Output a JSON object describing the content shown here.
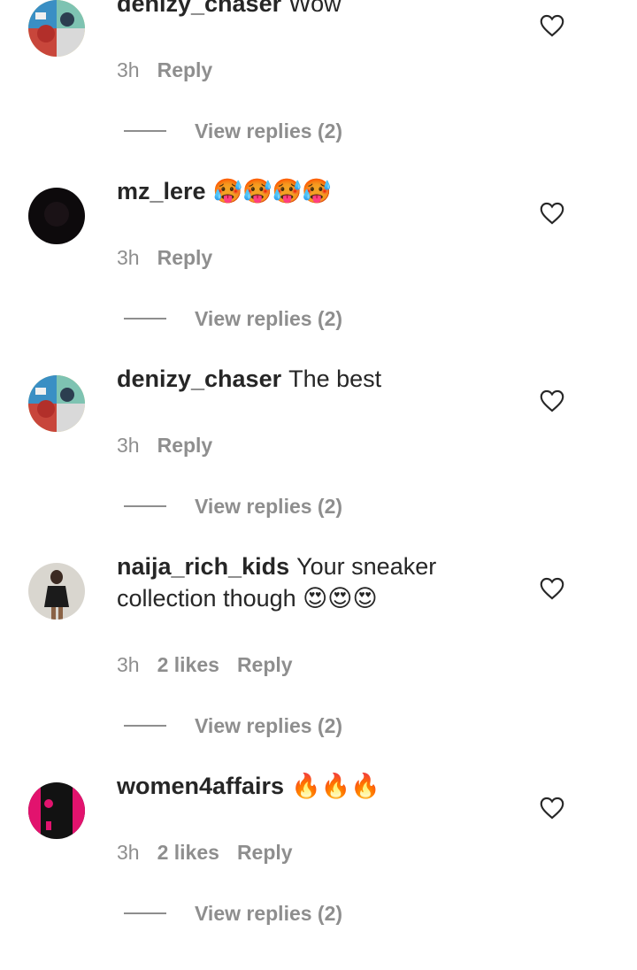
{
  "comments": [
    {
      "username": "denizy_chaser",
      "text": "Wow",
      "time": "3h",
      "likes": "",
      "reply_label": "Reply",
      "view_replies": "View replies (2)",
      "avatar": "collage"
    },
    {
      "username": "mz_lere",
      "text": "🥵🥵🥵🥵",
      "time": "3h",
      "likes": "",
      "reply_label": "Reply",
      "view_replies": "View replies (2)",
      "avatar": "dark"
    },
    {
      "username": "denizy_chaser",
      "text": "The best",
      "time": "3h",
      "likes": "",
      "reply_label": "Reply",
      "view_replies": "View replies (2)",
      "avatar": "collage"
    },
    {
      "username": "naija_rich_kids",
      "text": "Your sneaker collection though 😍😍😍",
      "time": "3h",
      "likes": "2 likes",
      "reply_label": "Reply",
      "view_replies": "View replies (2)",
      "avatar": "person"
    },
    {
      "username": "women4affairs",
      "text": "🔥🔥🔥",
      "time": "3h",
      "likes": "2 likes",
      "reply_label": "Reply",
      "view_replies": "View replies (2)",
      "avatar": "brand"
    }
  ],
  "icons": {
    "like": "heart-outline-icon"
  },
  "colors": {
    "text": "#262626",
    "muted": "#8e8e8e"
  }
}
